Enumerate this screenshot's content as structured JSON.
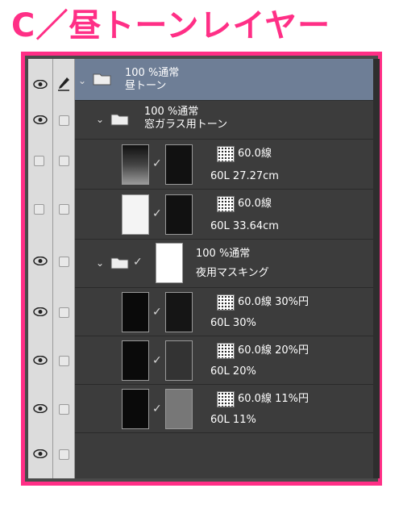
{
  "title": "C／昼トーンレイヤー",
  "layers": [
    {
      "blend": "100 %通常",
      "name": "昼トーン"
    },
    {
      "blend": "100 %通常",
      "name": "窓ガラス用トーン"
    },
    {
      "tone": "60.0線",
      "info": "60L 27.27cm"
    },
    {
      "tone": "60.0線",
      "info": "60L 33.64cm"
    },
    {
      "blend": "100 %通常",
      "name": "夜用マスキング"
    },
    {
      "tone": "60.0線 30%円",
      "info": "60L 30%"
    },
    {
      "tone": "60.0線 20%円",
      "info": "60L 20%"
    },
    {
      "tone": "60.0線 11%円",
      "info": "60L 11%"
    }
  ],
  "colors": {
    "accent": "#ff2f86",
    "selected": "#6e7e96",
    "panel": "#3c3c3c"
  }
}
